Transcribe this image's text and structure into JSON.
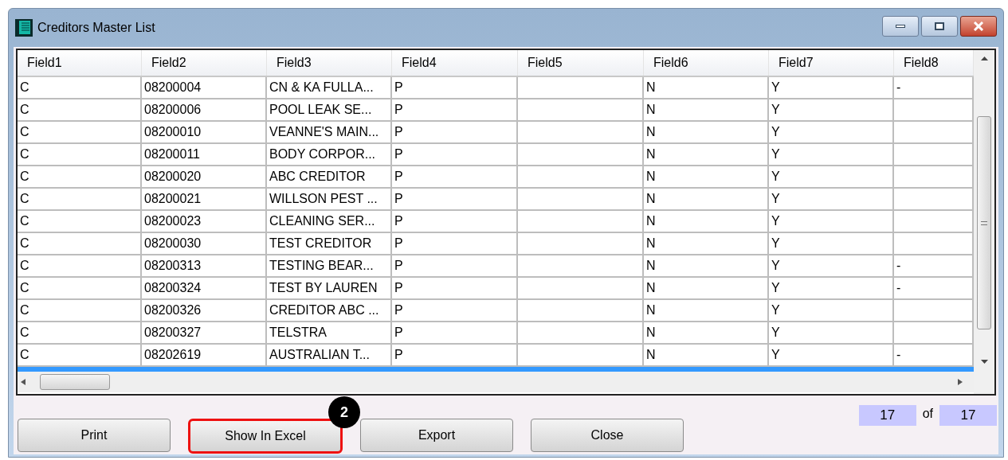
{
  "window": {
    "title": "Creditors Master List"
  },
  "table": {
    "columns": [
      "Field1",
      "Field2",
      "Field3",
      "Field4",
      "Field5",
      "Field6",
      "Field7",
      "Field8"
    ],
    "rows": [
      {
        "field1": "C",
        "field2": "08200004",
        "field3": "CN & KA FULLA...",
        "field4": "P",
        "field6": "N",
        "field7": "Y",
        "field8": "-"
      },
      {
        "field1": "C",
        "field2": "08200006",
        "field3": "POOL LEAK SE...",
        "field4": "P",
        "field6": "N",
        "field7": "Y"
      },
      {
        "field1": "C",
        "field2": "08200010",
        "field3": "VEANNE'S MAIN...",
        "field4": "P",
        "field6": "N",
        "field7": "Y"
      },
      {
        "field1": "C",
        "field2": "08200011",
        "field3": "BODY CORPOR...",
        "field4": "P",
        "field6": "N",
        "field7": "Y"
      },
      {
        "field1": "C",
        "field2": "08200020",
        "field3": "ABC CREDITOR",
        "field4": "P",
        "field6": "N",
        "field7": "Y"
      },
      {
        "field1": "C",
        "field2": "08200021",
        "field3": "WILLSON PEST ...",
        "field4": "P",
        "field6": "N",
        "field7": "Y"
      },
      {
        "field1": "C",
        "field2": "08200023",
        "field3": "CLEANING SER...",
        "field4": "P",
        "field6": "N",
        "field7": "Y"
      },
      {
        "field1": "C",
        "field2": "08200030",
        "field3": "TEST CREDITOR",
        "field4": "P",
        "field6": "N",
        "field7": "Y"
      },
      {
        "field1": "C",
        "field2": "08200313",
        "field3": "TESTING BEAR...",
        "field4": "P",
        "field6": "N",
        "field7": "Y",
        "field8": "-"
      },
      {
        "field1": "C",
        "field2": "08200324",
        "field3": "TEST BY LAUREN",
        "field4": "P",
        "field6": "N",
        "field7": "Y",
        "field8": "-"
      },
      {
        "field1": "C",
        "field2": "08200326",
        "field3": "CREDITOR ABC ...",
        "field4": "P",
        "field6": "N",
        "field7": "Y"
      },
      {
        "field1": "C",
        "field2": "08200327",
        "field3": "TELSTRA",
        "field4": "P",
        "field6": "N",
        "field7": "Y"
      },
      {
        "field1": "C",
        "field2": "08202619",
        "field3": "AUSTRALIAN T...",
        "field4": "P",
        "field6": "N",
        "field7": "Y",
        "field8": "-"
      }
    ]
  },
  "buttons": [
    {
      "label": "Print",
      "highlighted": false
    },
    {
      "label": "Show In Excel",
      "highlighted": true,
      "callout": "2"
    },
    {
      "label": "Export",
      "highlighted": false
    },
    {
      "label": "Close",
      "highlighted": false
    }
  ],
  "record_counter": {
    "current": "17",
    "separator": "of",
    "total": "17"
  }
}
